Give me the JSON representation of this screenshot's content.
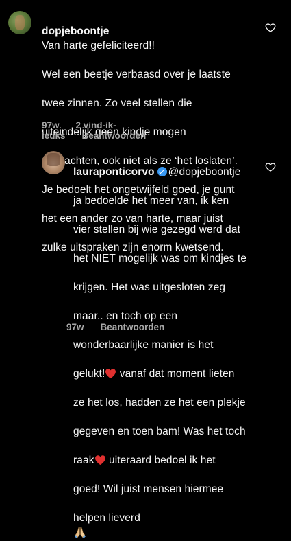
{
  "comments": [
    {
      "username": "dopjeboontje",
      "lines": [
        "Van harte gefeliciteerd!!",
        "Wel een beetje verbaasd over je laatste",
        "twee zinnen. Zo veel stellen die",
        "uiteindelijk geen kindje mogen",
        "verwachten, ook niet als ze ‘het loslaten’.",
        "Je bedoelt het ongetwijfeld goed, je gunt",
        "het een ander zo van harte, maar juist",
        "zulke uitspraken zijn enorm kwetsend."
      ],
      "time": "97w",
      "likes": "2 vind-ik-leuks",
      "reply_label": "Beantwoorden"
    },
    {
      "username": "lauraponticorvo",
      "verified": true,
      "mention": "@dopjeboontje",
      "lines": [
        "ja bedoelde het meer van, ik ken",
        "vier stellen bij wie gezegd werd dat",
        "het NIET mogelijk was om kindjes te",
        "krijgen. Het was uitgesloten zeg",
        "maar.. en toch op een",
        "wonderbaarlijke manier is het",
        "gelukt!",
        " vanaf dat moment lieten",
        "ze het los, hadden ze het een plekje",
        "gegeven en toen bam! Was het toch",
        "raak",
        " uiteraard bedoel ik het",
        "goed! Wil juist mensen hiermee",
        "helpen lieverd"
      ],
      "time": "97w",
      "reply_label": "Beantwoorden"
    }
  ],
  "icons": {
    "like": "heart-outline-icon",
    "red_heart": "red-heart-emoji",
    "prayer": "folded-hands-emoji",
    "verified": "verified-badge-icon"
  },
  "colors": {
    "background": "#000000",
    "text": "#f5f5f5",
    "meta": "#a8a8a8",
    "verified": "#3897f0",
    "red_heart": "#e0302f"
  }
}
